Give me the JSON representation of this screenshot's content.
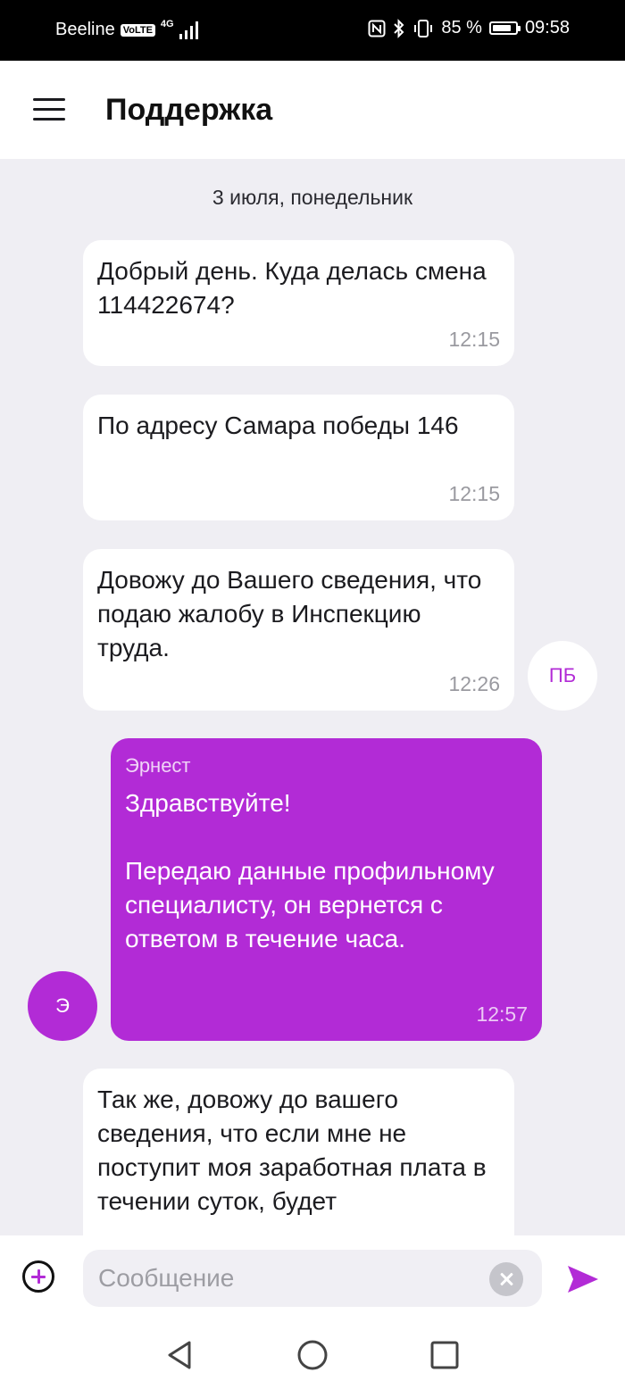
{
  "status_bar": {
    "carrier": "Beeline",
    "volte": "VoLTE",
    "network": "4G",
    "battery": "85 %",
    "battery_level": 0.85,
    "time": "09:58"
  },
  "header": {
    "title": "Поддержка"
  },
  "chat": {
    "date_label": "3 июля, понедельник",
    "messages": [
      {
        "text": "Добрый день. Куда делась смена 114422674?",
        "time": "12:15"
      },
      {
        "text": "По адресу Самара победы 146",
        "time": "12:15"
      },
      {
        "text": "Довожу до Вашего сведения, что подаю жалобу в Инспекцию труда.",
        "time": "12:26"
      },
      {
        "sender": "Эрнест",
        "text": "Здравствуйте!\n\nПередаю данные профильному специалисту, он вернется с ответом в течение часа.",
        "time": "12:57"
      },
      {
        "text": "Так же, довожу до вашего сведения, что если мне не поступит моя заработная плата в течении суток, будет"
      }
    ],
    "avatars": {
      "user_initials": "ПБ",
      "agent_initials": "Э"
    }
  },
  "composer": {
    "placeholder": "Сообщение"
  },
  "colors": {
    "accent": "#b22bd6",
    "chat_background": "#efeef3"
  },
  "icons": {
    "menu": "hamburger-menu-icon",
    "attach": "add-circle-icon",
    "clear": "clear-circle-icon",
    "send": "send-icon",
    "nav_back": "triangle-back-icon",
    "nav_home": "circle-home-icon",
    "nav_recents": "square-recents-icon"
  }
}
